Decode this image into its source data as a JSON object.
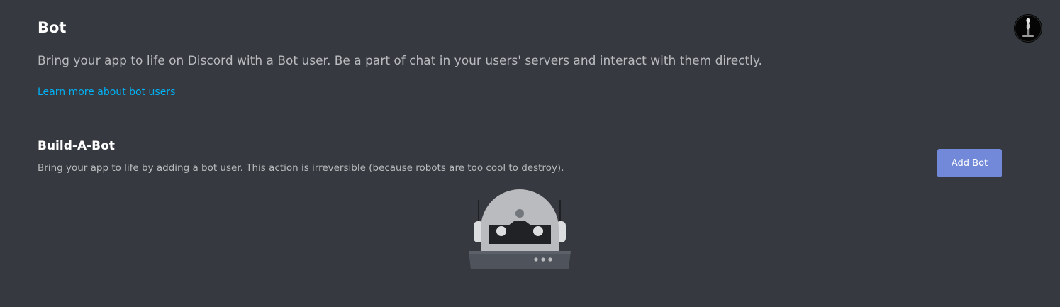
{
  "header": {
    "title": "Bot",
    "description": "Bring your app to life on Discord with a Bot user. Be a part of chat in your users' servers and interact with them directly.",
    "learn_more_link": "Learn more about bot users"
  },
  "build_a_bot": {
    "title": "Build-A-Bot",
    "description": "Bring your app to life by adding a bot user. This action is irreversible (because robots are too cool to destroy).",
    "add_bot_label": "Add Bot"
  },
  "user": {
    "avatar_icon": "user-avatar-icon"
  },
  "illustration": {
    "icon": "robot-icon"
  },
  "colors": {
    "background": "#36393f",
    "accent": "#7289da",
    "link": "#00b0f4",
    "text_primary": "#ffffff",
    "text_secondary": "#b9bbbe"
  }
}
